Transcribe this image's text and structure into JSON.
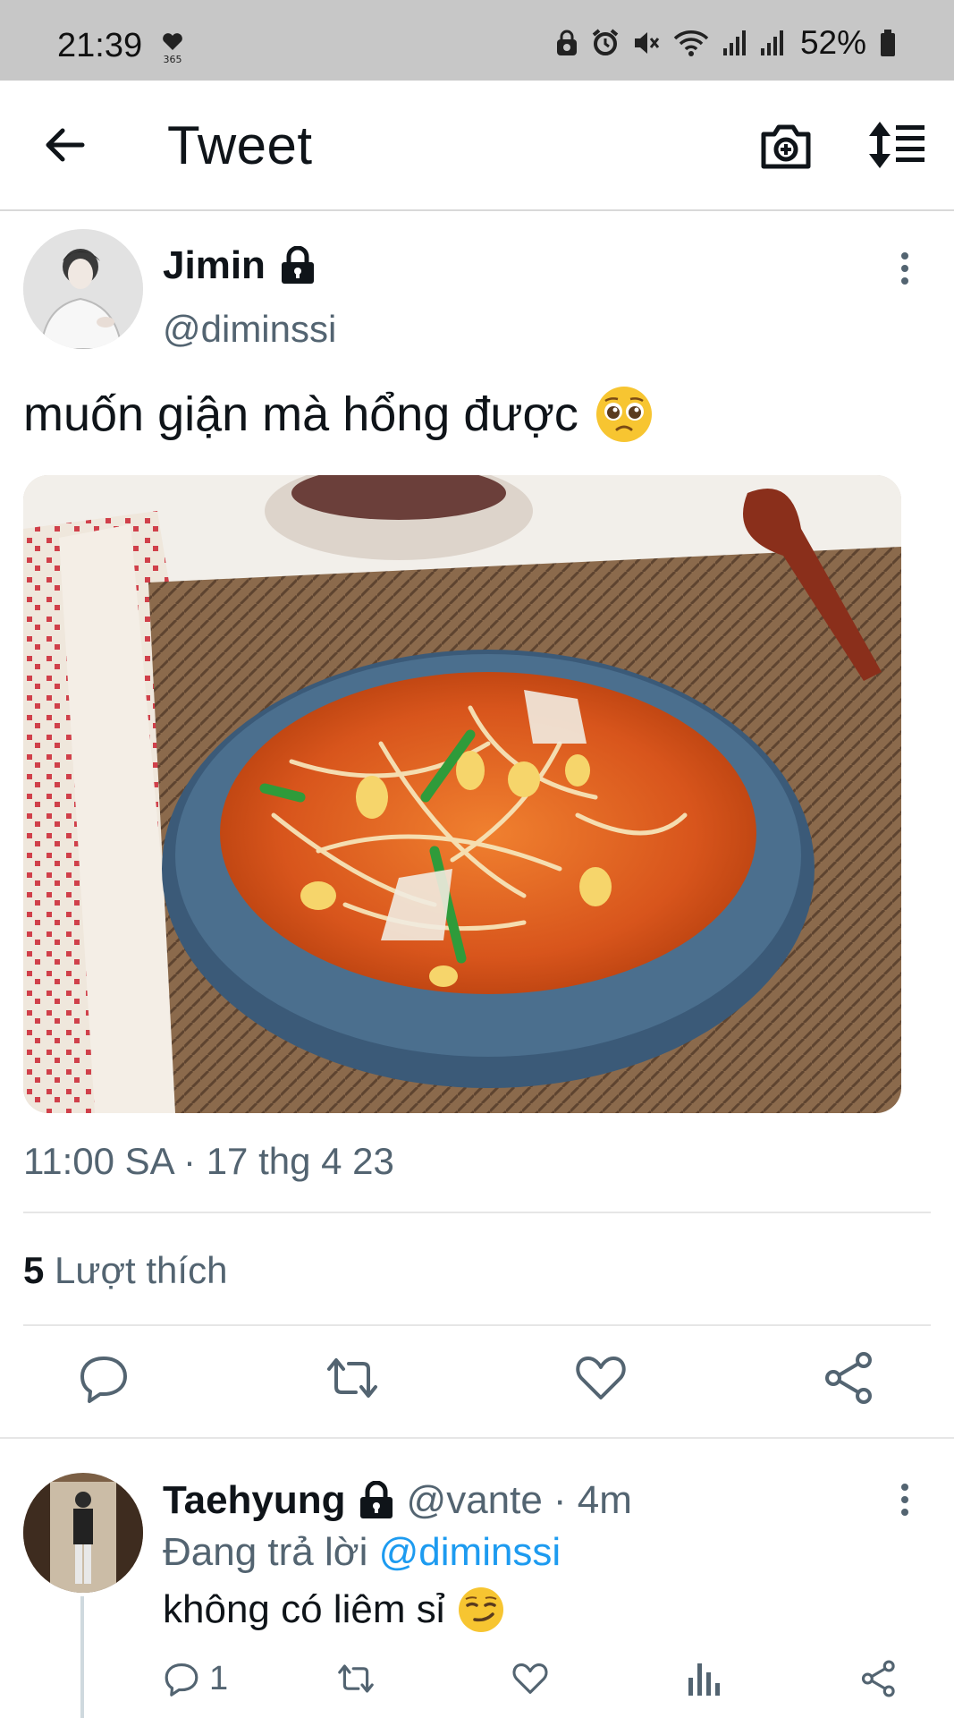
{
  "status_bar": {
    "time": "21:39",
    "heart_badge": "365",
    "battery": "52%",
    "icons": [
      "lock-icon",
      "alarm-icon",
      "mute-icon",
      "wifi-icon",
      "signal-icon",
      "signal-icon",
      "battery-icon"
    ]
  },
  "header": {
    "title": "Tweet",
    "back_icon": "arrow-left-icon",
    "camera_icon": "camera-add-icon",
    "sort_icon": "sort-icon"
  },
  "tweet": {
    "author_name": "Jimin",
    "handle": "@diminssi",
    "text": "muốn giận mà hổng được",
    "emoji": "pleading-face",
    "image_description_icon": "soup-photo",
    "timestamp": "11:00 SA · 17 thg 4 23",
    "likes_count": "5",
    "likes_label": "Lượt thích"
  },
  "reply": {
    "author_name": "Taehyung",
    "handle": "@vante",
    "time": "· 4m",
    "replying_prefix": "Đang trả lời",
    "replying_to": "@diminssi",
    "text": "không có liêm sỉ",
    "emoji": "smirking-face",
    "reply_count": "1"
  },
  "colors": {
    "status_bar_bg": "#c7c7c7",
    "text_primary": "#0f1419",
    "text_secondary": "#536471",
    "mention": "#1d9bf0"
  }
}
